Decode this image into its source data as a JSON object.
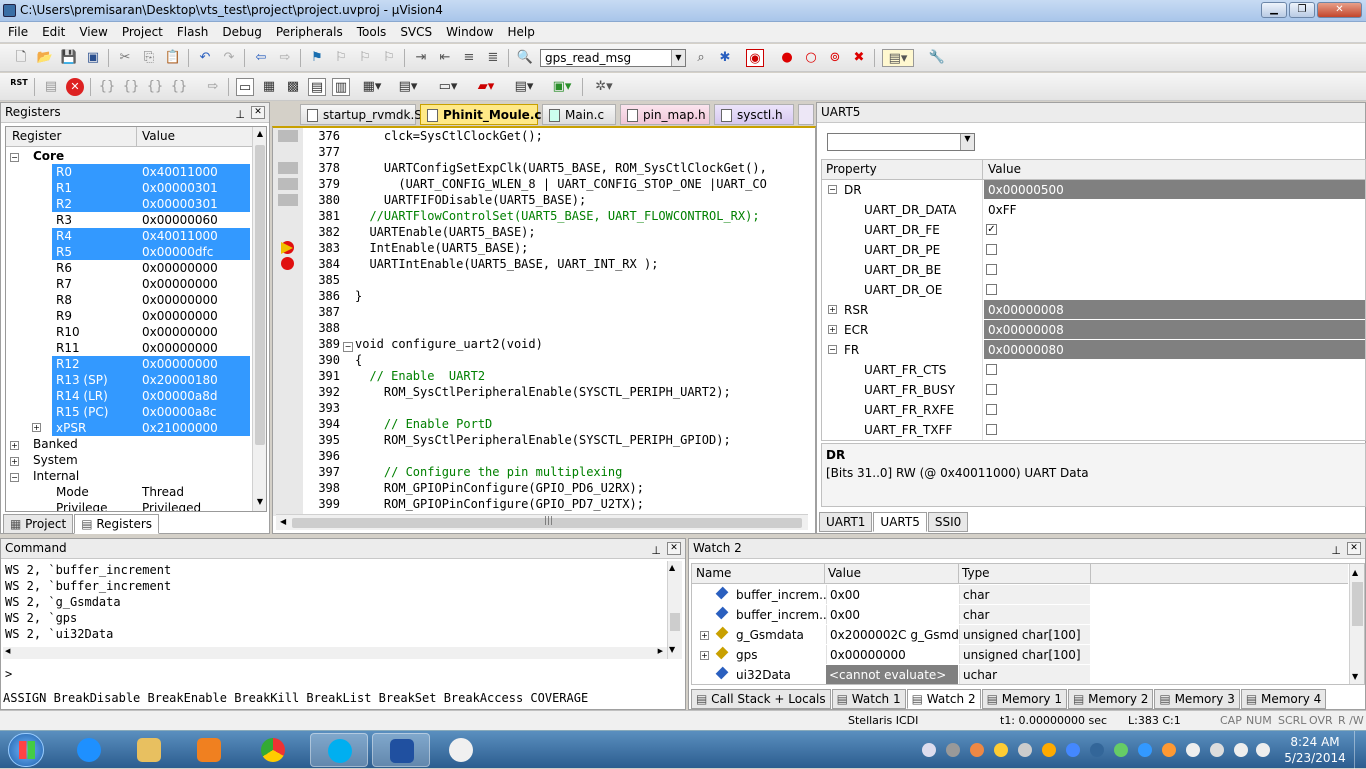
{
  "window": {
    "title": "C:\\Users\\premisaran\\Desktop\\vts_test\\project\\project.uvproj - µVision4",
    "minimize": "▁",
    "restore": "❐",
    "close": "✕"
  },
  "menu": [
    "File",
    "Edit",
    "View",
    "Project",
    "Flash",
    "Debug",
    "Peripherals",
    "Tools",
    "SVCS",
    "Window",
    "Help"
  ],
  "toolbar": {
    "find_combo": "gps_read_msg",
    "rst_label": "RST"
  },
  "registers": {
    "title": "Registers",
    "col_register": "Register",
    "col_value": "Value",
    "core_label": "Core",
    "rows": [
      {
        "name": "R0",
        "value": "0x40011000",
        "selected": true
      },
      {
        "name": "R1",
        "value": "0x00000301",
        "selected": true
      },
      {
        "name": "R2",
        "value": "0x00000301",
        "selected": true
      },
      {
        "name": "R3",
        "value": "0x00000060",
        "selected": false
      },
      {
        "name": "R4",
        "value": "0x40011000",
        "selected": true
      },
      {
        "name": "R5",
        "value": "0x00000dfc",
        "selected": true
      },
      {
        "name": "R6",
        "value": "0x00000000",
        "selected": false
      },
      {
        "name": "R7",
        "value": "0x00000000",
        "selected": false
      },
      {
        "name": "R8",
        "value": "0x00000000",
        "selected": false
      },
      {
        "name": "R9",
        "value": "0x00000000",
        "selected": false
      },
      {
        "name": "R10",
        "value": "0x00000000",
        "selected": false
      },
      {
        "name": "R11",
        "value": "0x00000000",
        "selected": false
      },
      {
        "name": "R12",
        "value": "0x00000000",
        "selected": true
      },
      {
        "name": "R13 (SP)",
        "value": "0x20000180",
        "selected": true
      },
      {
        "name": "R14 (LR)",
        "value": "0x00000a8d",
        "selected": true
      },
      {
        "name": "R15 (PC)",
        "value": "0x00000a8c",
        "selected": true
      },
      {
        "name": "xPSR",
        "value": "0x21000000",
        "selected": true
      }
    ],
    "groups": [
      "Banked",
      "System",
      "Internal"
    ],
    "internal_rows": [
      {
        "name": "Mode",
        "value": "Thread"
      },
      {
        "name": "Privilege",
        "value": "Privileged"
      }
    ],
    "tabs": [
      "Project",
      "Registers"
    ]
  },
  "editor": {
    "tabs": [
      "startup_rvmdk.S",
      "Phinit_Moule.c",
      "Main.c",
      "pin_map.h",
      "sysctl.h"
    ],
    "active_tab": 1,
    "lines": [
      {
        "n": "376",
        "text": "    clck=SysCtlClockGet();",
        "type": "code"
      },
      {
        "n": "377",
        "text": "",
        "type": "code"
      },
      {
        "n": "378",
        "text": "    UARTConfigSetExpClk(UART5_BASE, ROM_SysCtlClockGet(),",
        "type": "code"
      },
      {
        "n": "379",
        "text": "      (UART_CONFIG_WLEN_8 | UART_CONFIG_STOP_ONE |UART_CO",
        "type": "code"
      },
      {
        "n": "380",
        "text": "    UARTFIFODisable(UART5_BASE);",
        "type": "code"
      },
      {
        "n": "381",
        "text": "  //UARTFlowControlSet(UART5_BASE, UART_FLOWCONTROL_RX);",
        "type": "comment"
      },
      {
        "n": "382",
        "text": "  UARTEnable(UART5_BASE);",
        "type": "code"
      },
      {
        "n": "383",
        "text": "  IntEnable(UART5_BASE);",
        "type": "code"
      },
      {
        "n": "384",
        "text": "  UARTIntEnable(UART5_BASE, UART_INT_RX );",
        "type": "code"
      },
      {
        "n": "385",
        "text": "",
        "type": "code"
      },
      {
        "n": "386",
        "text": "}",
        "type": "code"
      },
      {
        "n": "387",
        "text": "",
        "type": "code"
      },
      {
        "n": "388",
        "text": "",
        "type": "code"
      },
      {
        "n": "389",
        "text": "void configure_uart2(void)",
        "type": "code"
      },
      {
        "n": "390",
        "text": "{",
        "type": "code"
      },
      {
        "n": "391",
        "text": "  // Enable  UART2",
        "type": "comment"
      },
      {
        "n": "392",
        "text": "    ROM_SysCtlPeripheralEnable(SYSCTL_PERIPH_UART2);",
        "type": "code"
      },
      {
        "n": "393",
        "text": "",
        "type": "code"
      },
      {
        "n": "394",
        "text": "    // Enable PortD",
        "type": "comment"
      },
      {
        "n": "395",
        "text": "    ROM_SysCtlPeripheralEnable(SYSCTL_PERIPH_GPIOD);",
        "type": "code"
      },
      {
        "n": "396",
        "text": "",
        "type": "code"
      },
      {
        "n": "397",
        "text": "    // Configure the pin multiplexing",
        "type": "comment"
      },
      {
        "n": "398",
        "text": "    ROM_GPIOPinConfigure(GPIO_PD6_U2RX);",
        "type": "code"
      },
      {
        "n": "399",
        "text": "    ROM_GPIOPinConfigure(GPIO_PD7_U2TX);",
        "type": "code"
      }
    ]
  },
  "uart": {
    "title": "UART5",
    "col_property": "Property",
    "col_value": "Value",
    "rows": [
      {
        "name": "DR",
        "value": "0x00000500",
        "level": 0,
        "expand": "−",
        "kind": "group"
      },
      {
        "name": "UART_DR_DATA",
        "value": "0xFF",
        "level": 1,
        "kind": "text"
      },
      {
        "name": "UART_DR_FE",
        "value": "✓",
        "level": 1,
        "kind": "check"
      },
      {
        "name": "UART_DR_PE",
        "value": "",
        "level": 1,
        "kind": "check"
      },
      {
        "name": "UART_DR_BE",
        "value": "",
        "level": 1,
        "kind": "check"
      },
      {
        "name": "UART_DR_OE",
        "value": "",
        "level": 1,
        "kind": "check"
      },
      {
        "name": "RSR",
        "value": "0x00000008",
        "level": 0,
        "expand": "+",
        "kind": "group"
      },
      {
        "name": "ECR",
        "value": "0x00000008",
        "level": 0,
        "expand": "+",
        "kind": "group"
      },
      {
        "name": "FR",
        "value": "0x00000080",
        "level": 0,
        "expand": "−",
        "kind": "group"
      },
      {
        "name": "UART_FR_CTS",
        "value": "",
        "level": 1,
        "kind": "check"
      },
      {
        "name": "UART_FR_BUSY",
        "value": "",
        "level": 1,
        "kind": "check"
      },
      {
        "name": "UART_FR_RXFE",
        "value": "",
        "level": 1,
        "kind": "check"
      },
      {
        "name": "UART_FR_TXFF",
        "value": "",
        "level": 1,
        "kind": "check"
      }
    ],
    "desc_title": "DR",
    "desc_text": "[Bits 31..0] RW (@ 0x40011000) UART Data",
    "tabs": [
      "UART1",
      "UART5",
      "SSI0"
    ]
  },
  "command": {
    "title": "Command",
    "lines": [
      "WS 2, `buffer_increment",
      "WS 2, `buffer_increment",
      "WS 2, `g_Gsmdata",
      "WS 2, `gps",
      "WS 2, `ui32Data"
    ],
    "prompt": ">",
    "hint": "ASSIGN BreakDisable BreakEnable BreakKill BreakList BreakSet BreakAccess COVERAGE"
  },
  "watch": {
    "title": "Watch 2",
    "col_name": "Name",
    "col_value": "Value",
    "col_type": "Type",
    "rows": [
      {
        "name": "buffer_increm...",
        "value": "0x00",
        "type": "char",
        "expand": ""
      },
      {
        "name": "buffer_increm...",
        "value": "0x00",
        "type": "char",
        "expand": ""
      },
      {
        "name": "g_Gsmdata",
        "value": "0x2000002C g_Gsmdat...",
        "type": "unsigned char[100]",
        "expand": "+"
      },
      {
        "name": "gps",
        "value": "0x00000000",
        "type": "unsigned char[100]",
        "expand": "+"
      },
      {
        "name": "ui32Data",
        "value": "<cannot evaluate>",
        "type": "uchar",
        "expand": ""
      }
    ],
    "tabs": [
      "Call Stack + Locals",
      "Watch 1",
      "Watch 2",
      "Memory 1",
      "Memory 2",
      "Memory 3",
      "Memory 4"
    ]
  },
  "status": {
    "target": "Stellaris ICDI",
    "time": "t1: 0.00000000 sec",
    "pos": "L:383 C:1",
    "caps": "CAP",
    "num": "NUM",
    "scrl": "SCRL",
    "ovr": "OVR",
    "rw": "R /W"
  },
  "taskbar": {
    "time": "8:24 AM",
    "date": "5/23/2014"
  }
}
